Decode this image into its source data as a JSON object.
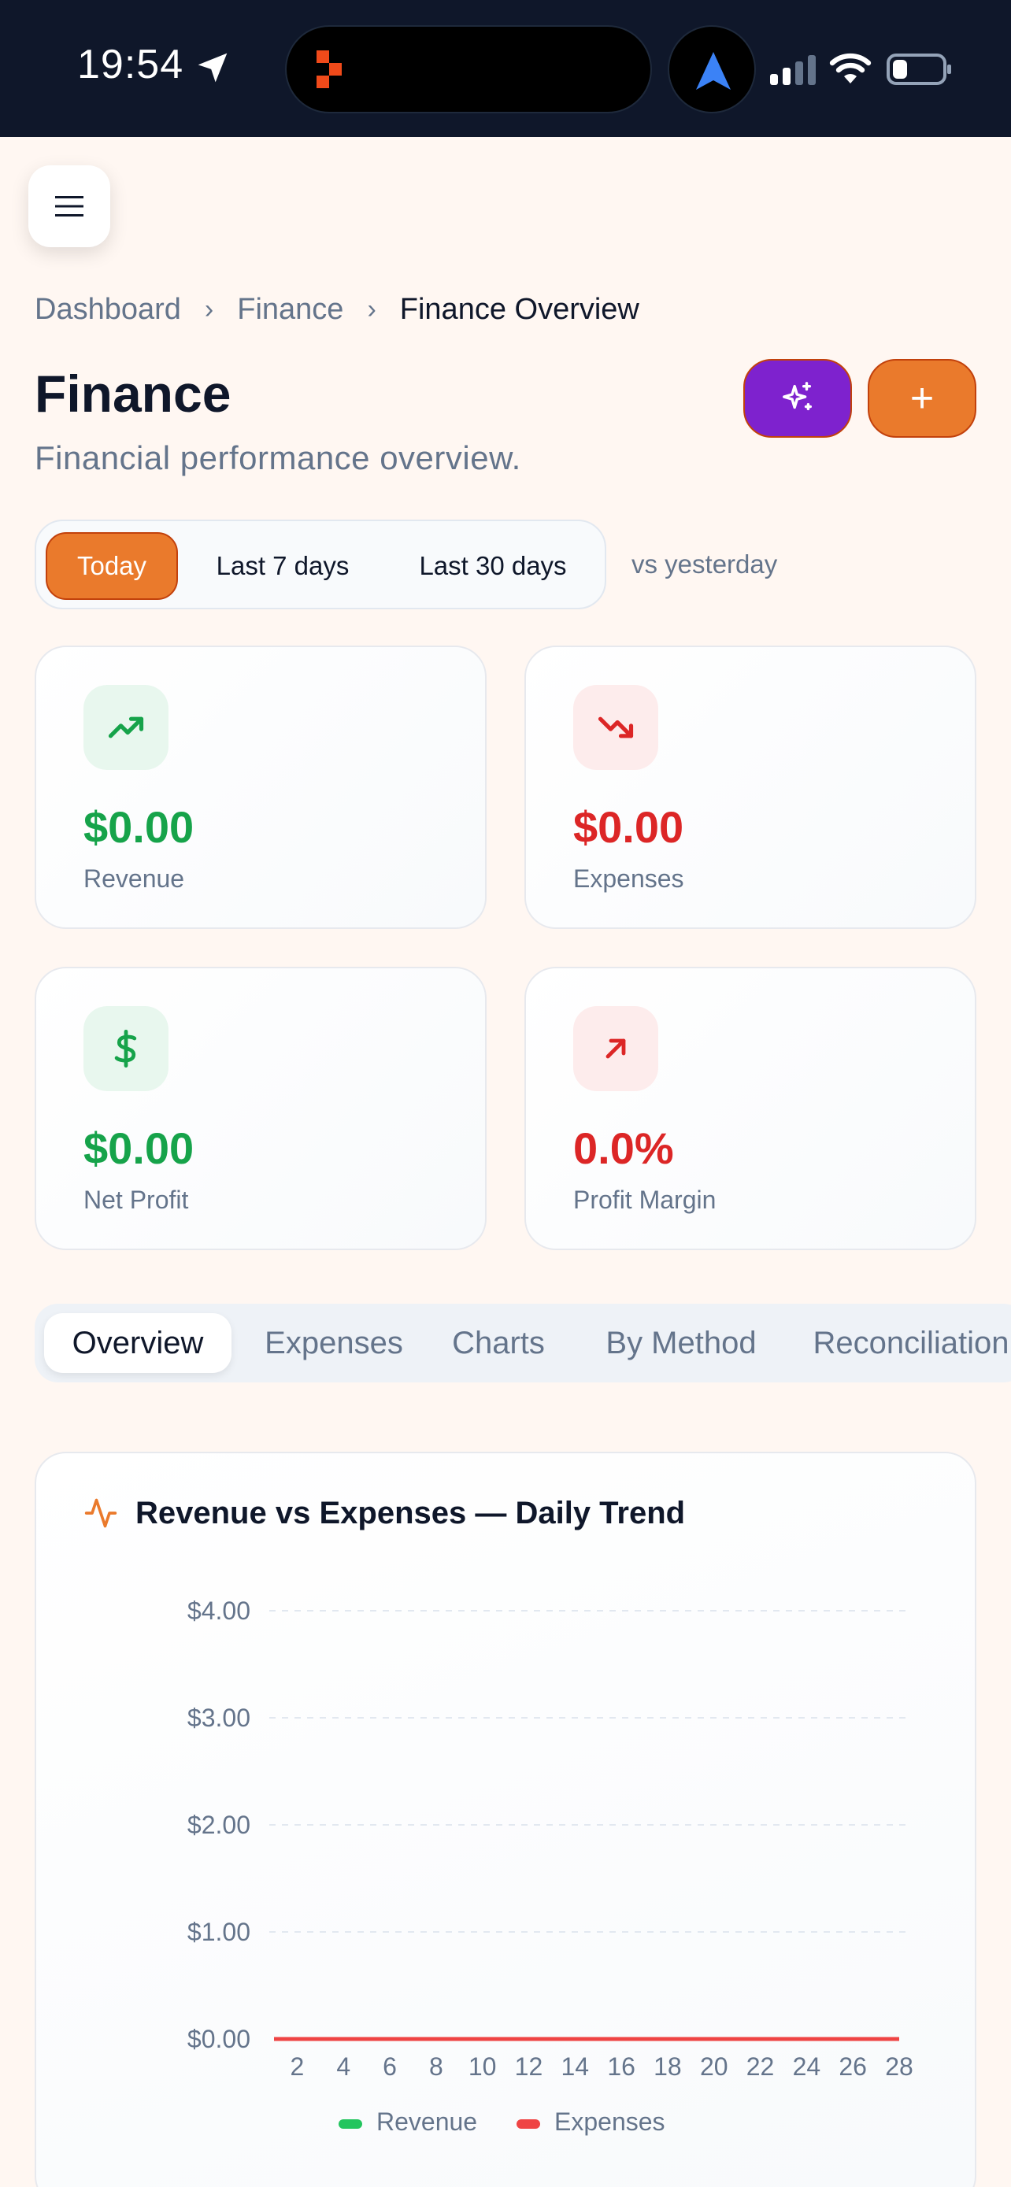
{
  "status_bar": {
    "time": "19:54"
  },
  "breadcrumb": {
    "items": [
      "Dashboard",
      "Finance"
    ],
    "current": "Finance Overview",
    "separator": "›"
  },
  "page": {
    "title": "Finance",
    "subtitle": "Financial performance overview."
  },
  "actions": {
    "add_label": "+"
  },
  "range": {
    "options": [
      "Today",
      "Last 7 days",
      "Last 30 days"
    ],
    "active": "Today",
    "compare_label": "vs yesterday"
  },
  "stats": [
    {
      "value": "$0.00",
      "label": "Revenue",
      "icon": "trending-up-icon",
      "tone": "green"
    },
    {
      "value": "$0.00",
      "label": "Expenses",
      "icon": "trending-down-icon",
      "tone": "red"
    },
    {
      "value": "$0.00",
      "label": "Net Profit",
      "icon": "dollar-icon",
      "tone": "green"
    },
    {
      "value": "0.0%",
      "label": "Profit Margin",
      "icon": "arrow-up-right-icon",
      "tone": "red"
    }
  ],
  "tabs": [
    "Overview",
    "Expenses",
    "Charts",
    "By Method",
    "Reconciliation"
  ],
  "active_tab": "Overview",
  "colors": {
    "accent": "#ea7a2c",
    "ai": "#7e22ce",
    "positive": "#16a34a",
    "negative": "#dc2626",
    "revenue_series": "#22c55e",
    "expenses_series": "#ef4444"
  },
  "chart_data": {
    "type": "line",
    "title": "Revenue vs Expenses — Daily Trend",
    "x": [
      1,
      2,
      3,
      4,
      5,
      6,
      7,
      8,
      9,
      10,
      11,
      12,
      13,
      14,
      15,
      16,
      17,
      18,
      19,
      20,
      21,
      22,
      23,
      24,
      25,
      26,
      27,
      28
    ],
    "x_ticks": [
      "2",
      "4",
      "6",
      "8",
      "10",
      "12",
      "14",
      "16",
      "18",
      "20",
      "22",
      "24",
      "26",
      "28"
    ],
    "y_ticks": [
      "$0.00",
      "$1.00",
      "$2.00",
      "$3.00",
      "$4.00"
    ],
    "ylim": [
      0,
      4
    ],
    "grid": true,
    "legend_position": "bottom",
    "series": [
      {
        "name": "Revenue",
        "color": "#22c55e",
        "values": [
          0,
          0,
          0,
          0,
          0,
          0,
          0,
          0,
          0,
          0,
          0,
          0,
          0,
          0,
          0,
          0,
          0,
          0,
          0,
          0,
          0,
          0,
          0,
          0,
          0,
          0,
          0,
          0
        ]
      },
      {
        "name": "Expenses",
        "color": "#ef4444",
        "values": [
          0,
          0,
          0,
          0,
          0,
          0,
          0,
          0,
          0,
          0,
          0,
          0,
          0,
          0,
          0,
          0,
          0,
          0,
          0,
          0,
          0,
          0,
          0,
          0,
          0,
          0,
          0,
          0
        ]
      }
    ]
  }
}
